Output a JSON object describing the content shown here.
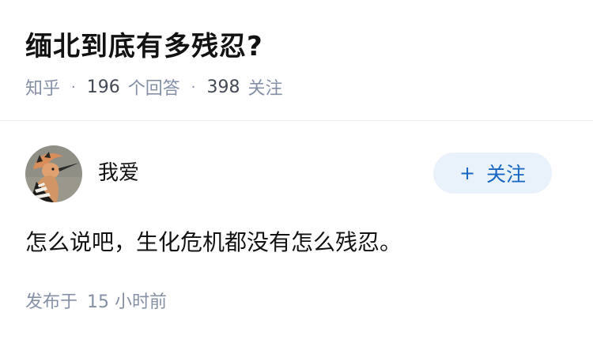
{
  "question": {
    "title": "缅北到底有多残忍?",
    "meta": {
      "brand": "知乎",
      "separator": "·",
      "answer_count": "196",
      "answer_label": "个回答",
      "follower_count": "398",
      "follower_label": "关注"
    }
  },
  "answer": {
    "author": {
      "name": "我爱",
      "avatar_icon": "hoopoe-bird-avatar"
    },
    "follow_button": {
      "icon": "+",
      "label": "关注"
    },
    "content": "怎么说吧，生化危机都没有怎么残忍。",
    "time": {
      "prefix": "发布于",
      "value": "15 小时前"
    }
  },
  "colors": {
    "title": "#121212",
    "meta": "#8590a6",
    "accent": "#1766c2",
    "follow_bg": "#e9f1fb",
    "divider": "#ededed"
  }
}
